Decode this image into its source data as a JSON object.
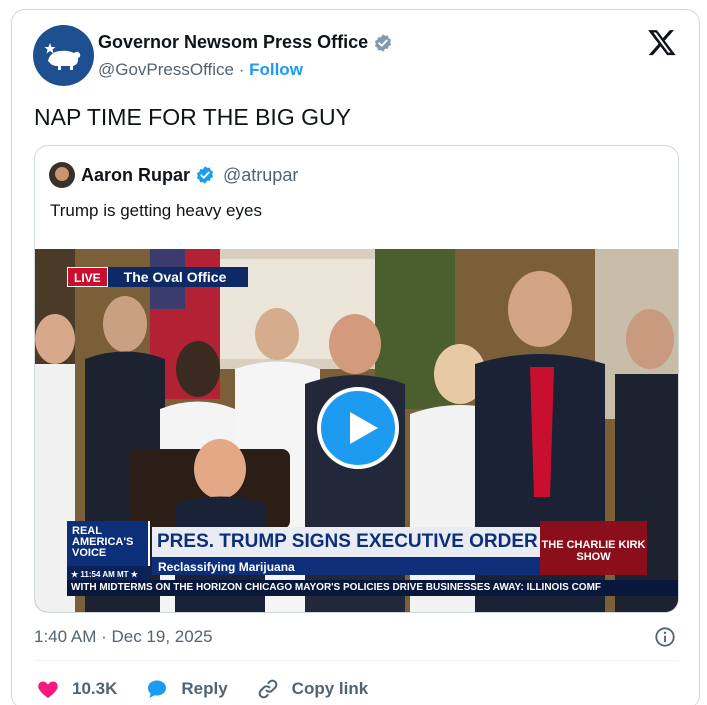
{
  "post": {
    "author_name": "Governor Newsom Press Office",
    "author_handle": "@GovPressOffice",
    "separator": " · ",
    "follow_label": "Follow",
    "text": "NAP TIME FOR THE BIG GUY",
    "timestamp": "1:40 AM · Dec 19, 2025"
  },
  "quote": {
    "author_name": "Aaron Rupar",
    "author_handle": "@atrupar",
    "text": "Trump is getting heavy eyes"
  },
  "video": {
    "live_label": "LIVE",
    "location_label": "The Oval Office",
    "network_line1": "REAL",
    "network_line2": "AMERICA'S",
    "network_line3": "VOICE",
    "network_time": "★ 11:54 AM MT ★",
    "headline": "PRES. TRUMP SIGNS EXECUTIVE ORDER",
    "subheadline": "Reclassifying Marijuana",
    "show_label": "THE CHARLIE KIRK SHOW",
    "ticker": "WITH MIDTERMS ON THE HORIZON     CHICAGO MAYOR'S POLICIES DRIVE BUSINESSES AWAY: ILLINOIS COMF"
  },
  "actions": {
    "like_count": "10.3K",
    "reply_label": "Reply",
    "copy_link_label": "Copy link"
  },
  "colors": {
    "accent": "#1d9bf0",
    "like": "#f91880",
    "text_primary": "#0f1419",
    "text_secondary": "#536471",
    "border": "#cfd9de"
  },
  "icons": {
    "header": "x-logo-icon",
    "verified": "verified-badge-icon",
    "info": "info-icon",
    "like": "heart-icon",
    "reply": "speech-bubble-icon",
    "copy": "link-icon",
    "play": "play-icon"
  }
}
